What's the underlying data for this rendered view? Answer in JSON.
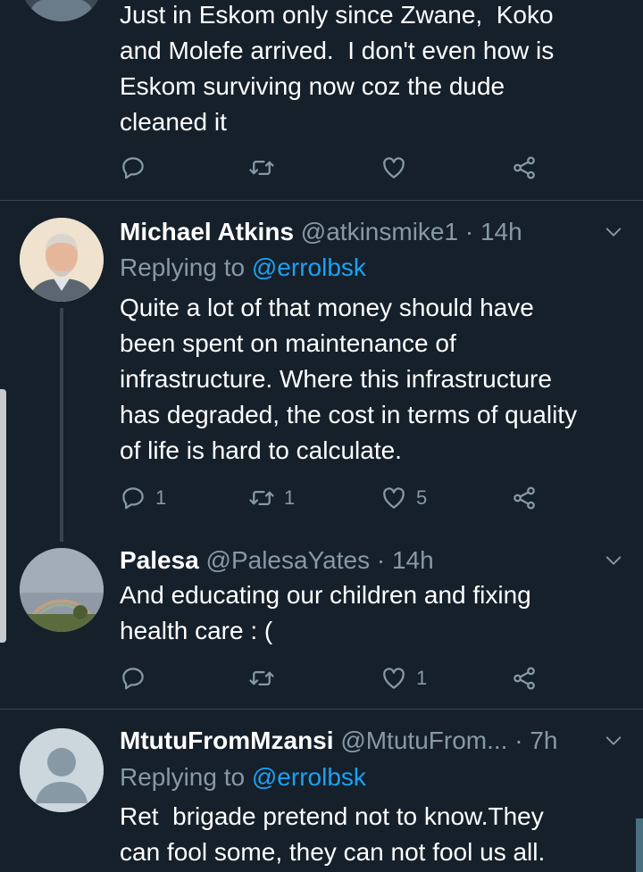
{
  "tweets": [
    {
      "text": "Just in Eskom only since Zwane,  Koko\nand Molefe arrived.  I don't even how is\nEskom surviving now coz the dude\ncleaned it",
      "actions": {
        "reply_count": "",
        "retweet_count": "",
        "like_count": ""
      }
    },
    {
      "name": "Michael Atkins",
      "handle": "@atkinsmike1",
      "separator": "·",
      "time": "14h",
      "replying_prefix": "Replying to ",
      "replying_to": "@errolbsk",
      "text": "Quite a lot of that money should have\nbeen spent on maintenance of\ninfrastructure. Where this infrastructure\nhas degraded, the cost in terms of quality\nof life is hard to calculate.",
      "actions": {
        "reply_count": "1",
        "retweet_count": "1",
        "like_count": "5"
      }
    },
    {
      "name": "Palesa",
      "handle": "@PalesaYates",
      "separator": "·",
      "time": "14h",
      "text": "And educating our children and fixing\nhealth care : (",
      "actions": {
        "reply_count": "",
        "retweet_count": "",
        "like_count": "1"
      }
    },
    {
      "name": "MtutuFromMzansi",
      "handle": "@MtutuFrom...",
      "separator": "·",
      "time": "7h",
      "replying_prefix": "Replying to ",
      "replying_to": "@errolbsk",
      "text": "Ret  brigade pretend not to know.They\ncan fool some, they can not fool us all."
    }
  ],
  "icons": {
    "reply": "reply-icon",
    "retweet": "retweet-icon",
    "like": "heart-icon",
    "share": "share-icon",
    "more": "chevron-down-icon"
  },
  "colors": {
    "background": "#15202b",
    "text": "#ffffff",
    "secondary": "#8899a6",
    "link": "#1da1f2",
    "divider": "#38444d"
  }
}
